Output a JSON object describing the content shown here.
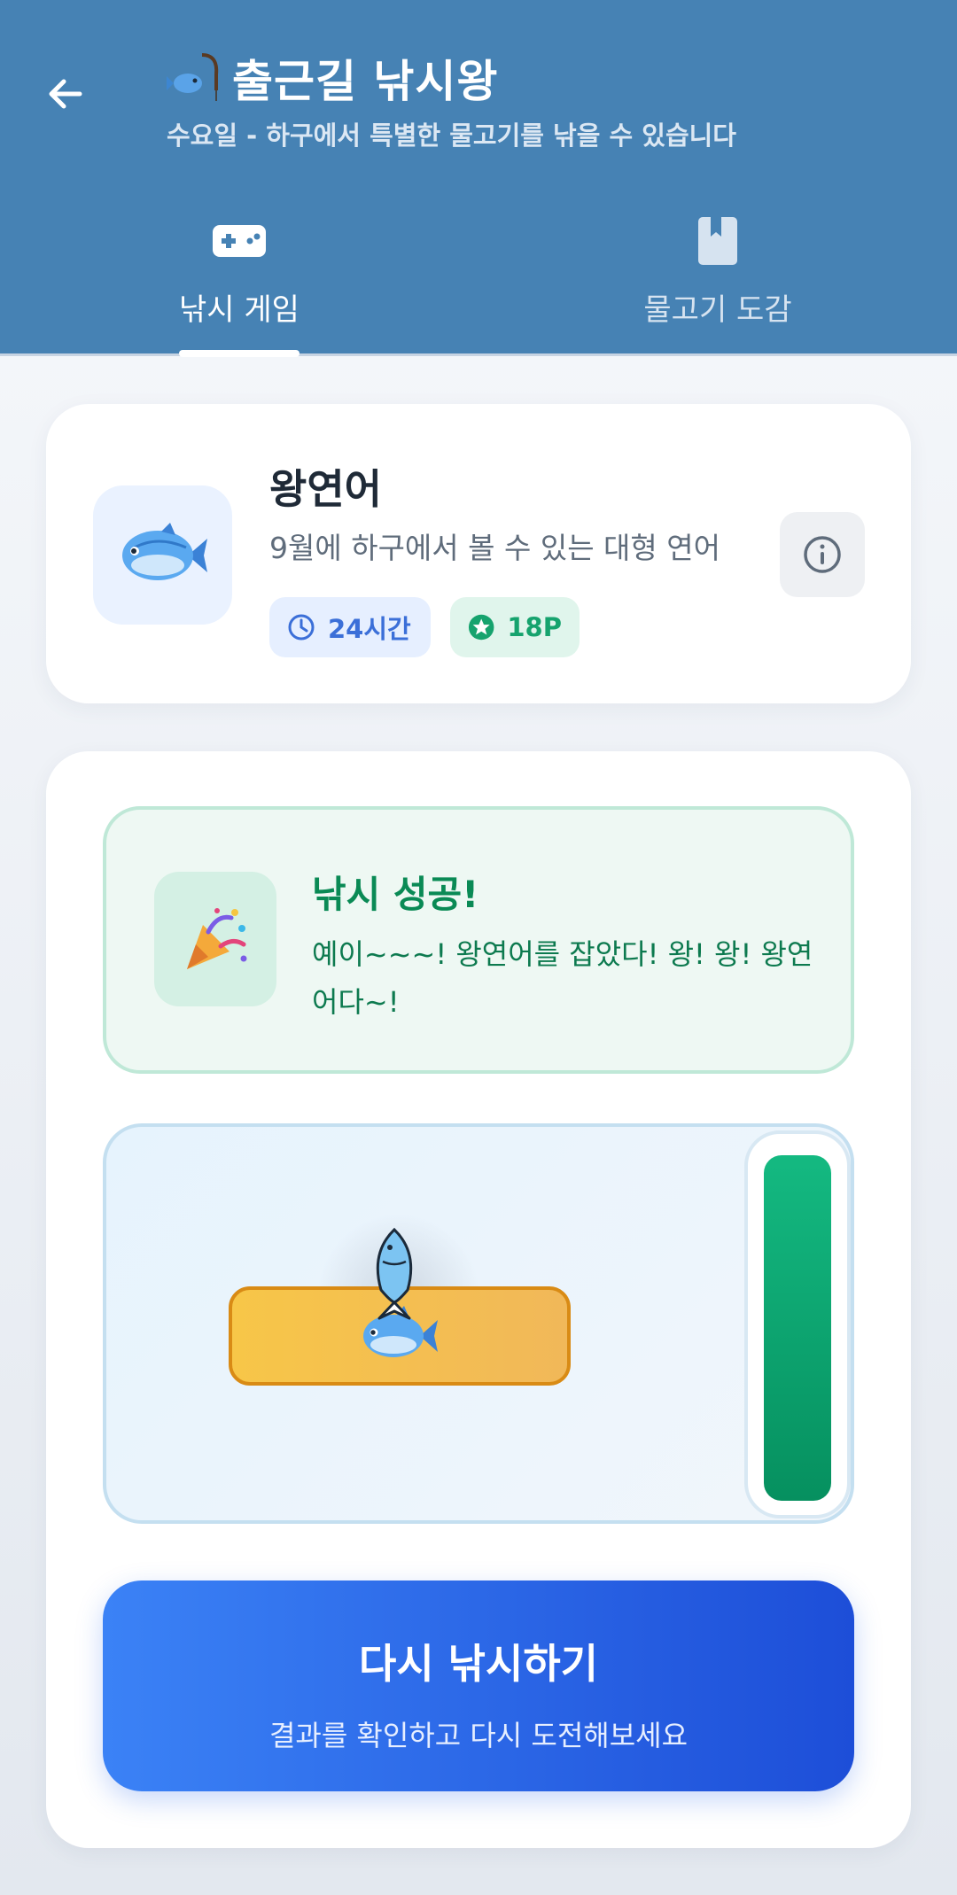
{
  "header": {
    "title": "출근길 낚시왕",
    "subtitle": "수요일 - 하구에서 특별한 물고기를 낚을 수 있습니다",
    "back_icon": "arrow-left-icon",
    "title_icon": "fishing-rod-icon"
  },
  "tabs": [
    {
      "label": "낚시 게임",
      "icon": "gamepad-icon",
      "active": true
    },
    {
      "label": "물고기 도감",
      "icon": "book-icon",
      "active": false
    }
  ],
  "fish": {
    "name": "왕연어",
    "description": "9월에 하구에서 볼 수 있는 대형 연어",
    "time": "24시간",
    "points": "18P",
    "icon": "fish-icon"
  },
  "result": {
    "title": "낚시 성공!",
    "message": "예이~~~! 왕연어를 잡았다! 왕! 왕! 왕연어다~!",
    "icon": "party-popper-icon"
  },
  "game": {
    "tension_level": 1.0
  },
  "retry": {
    "label": "다시 낚시하기",
    "sublabel": "결과를 확인하고 다시 도전해보세요"
  },
  "colors": {
    "header": "#4682b4",
    "success": "#0a8a55",
    "button_start": "#3b82f6",
    "button_end": "#1d4ed8"
  }
}
